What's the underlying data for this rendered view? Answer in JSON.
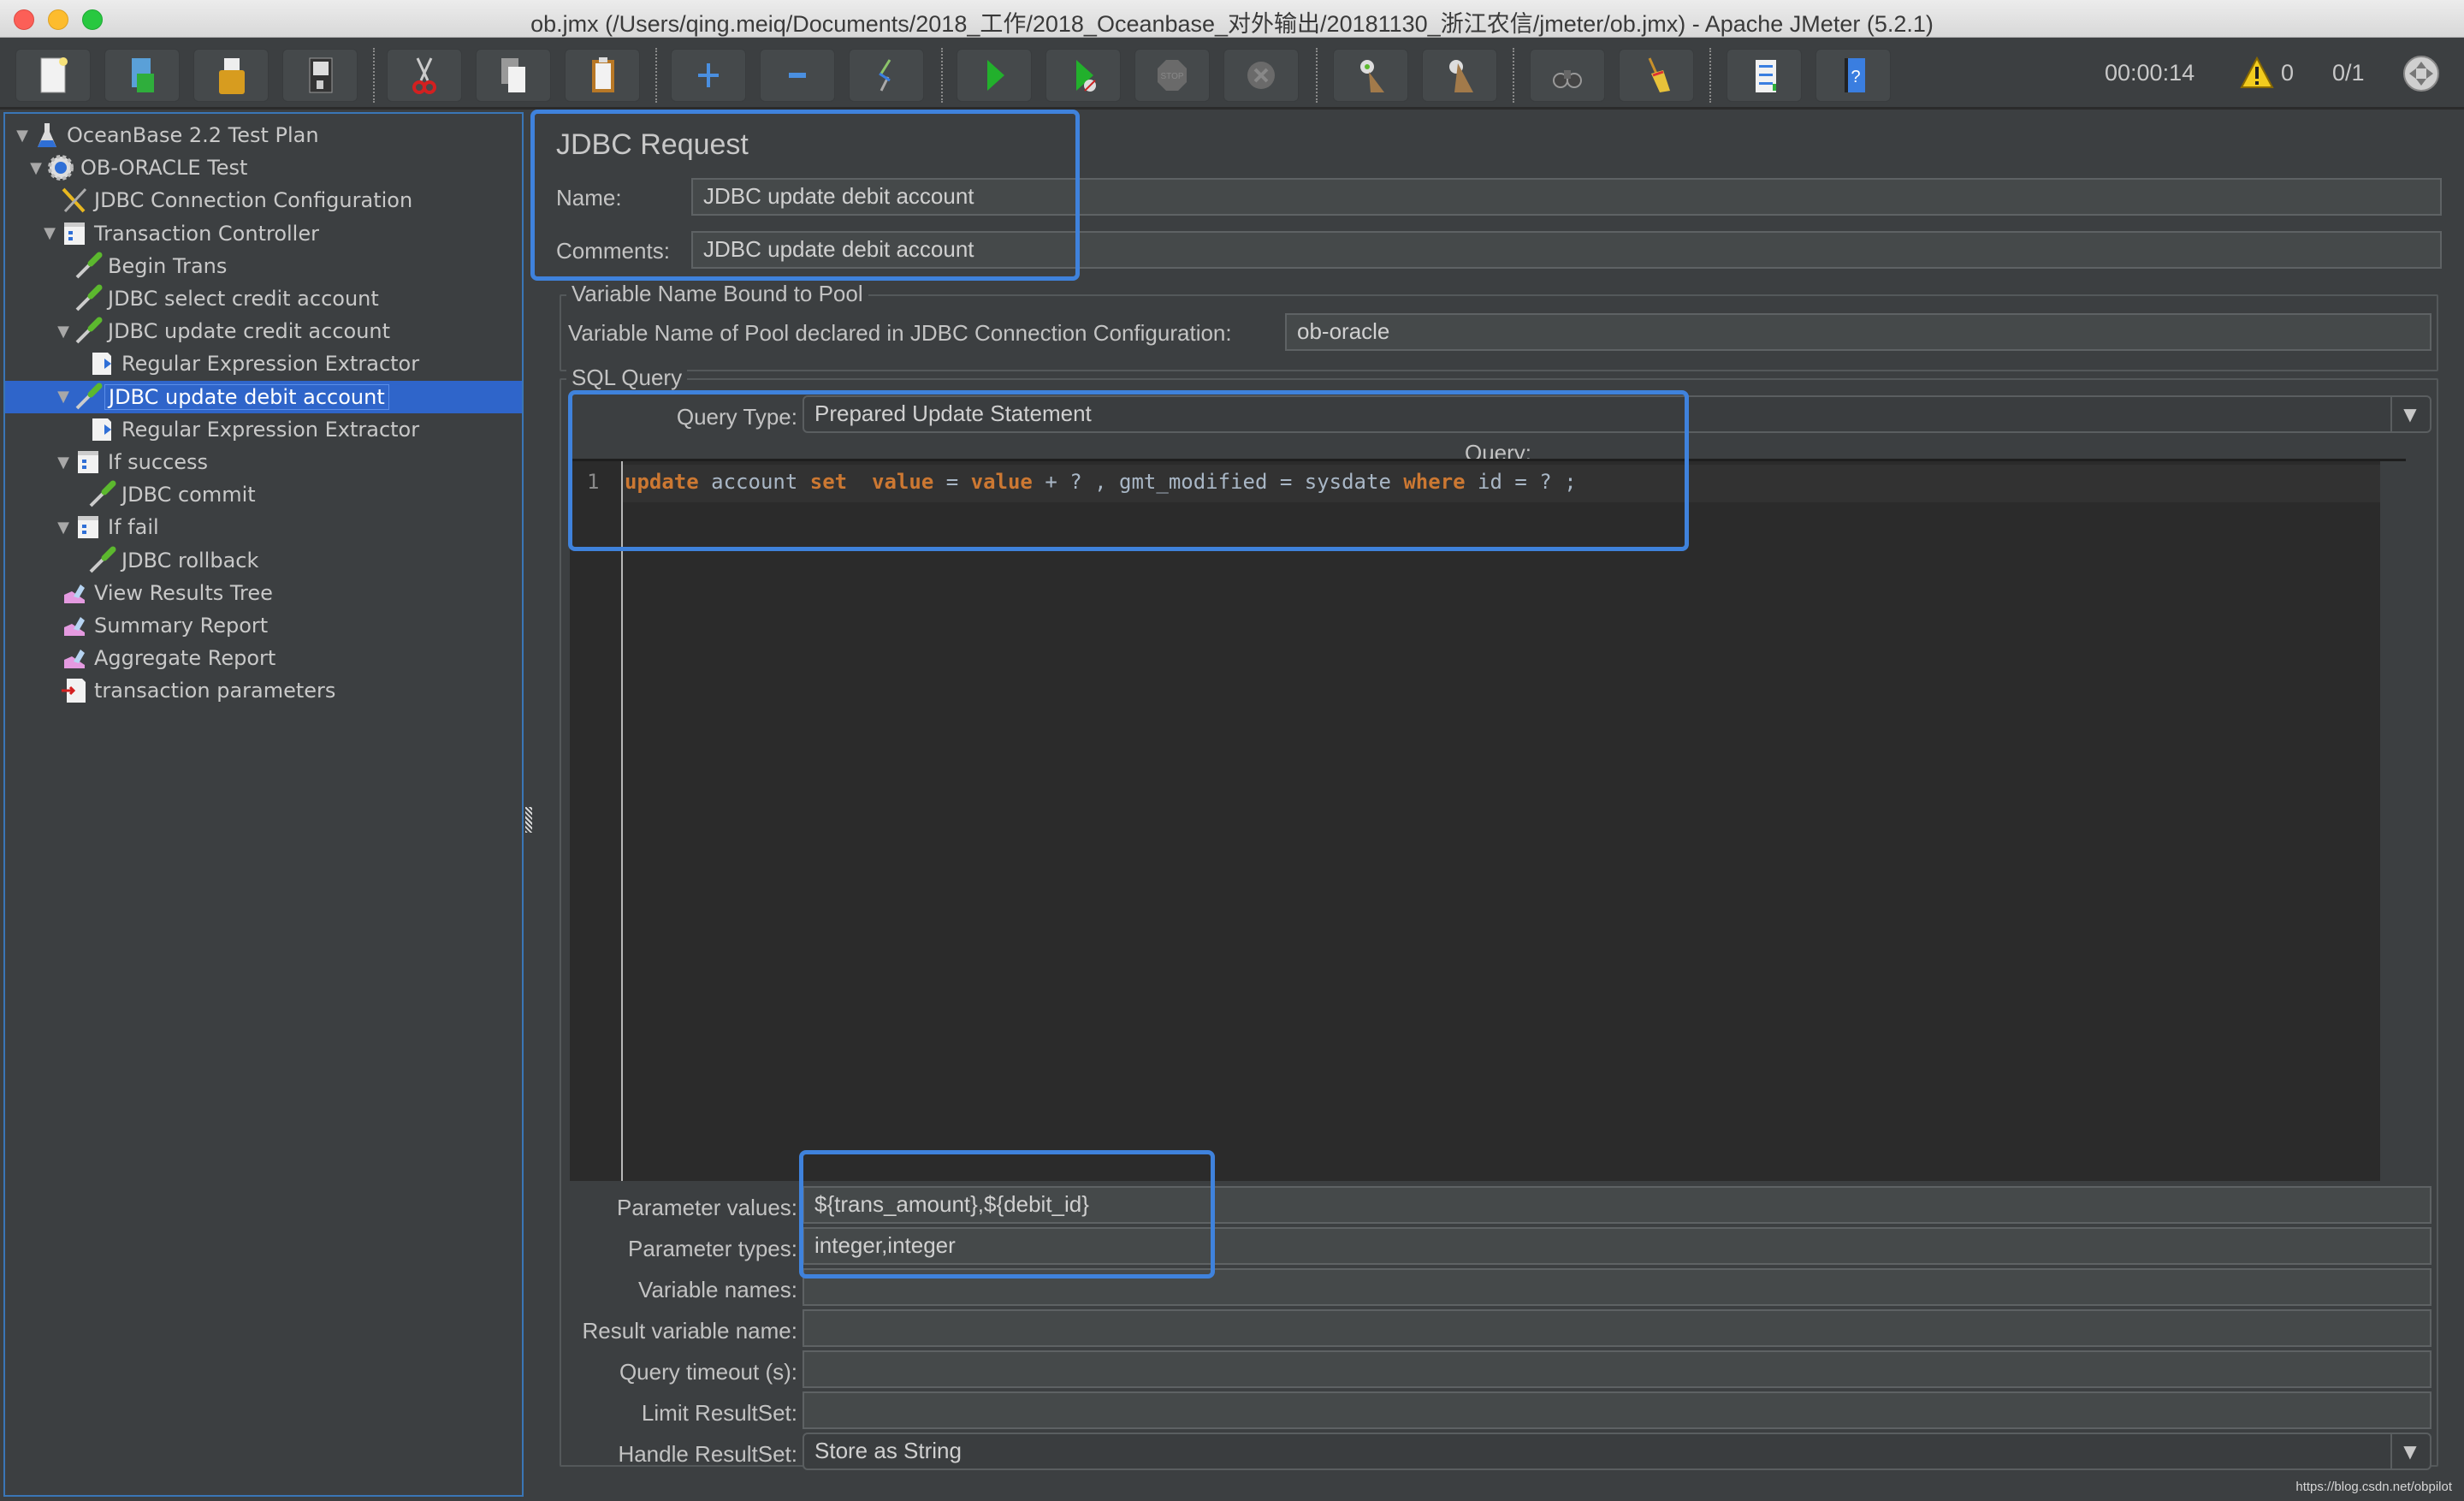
{
  "window": {
    "title": "ob.jmx (/Users/qing.meiq/Documents/2018_工作/2018_Oceanbase_对外输出/20181130_浙江农信/jmeter/ob.jmx) - Apache JMeter (5.2.1)"
  },
  "toolbar": {
    "buttons": [
      {
        "name": "new",
        "icon": "new-document-icon"
      },
      {
        "name": "templates",
        "icon": "templates-icon"
      },
      {
        "name": "open",
        "icon": "open-folder-icon"
      },
      {
        "name": "save",
        "icon": "save-disk-icon"
      },
      {
        "name": "cut",
        "icon": "scissors-icon"
      },
      {
        "name": "copy",
        "icon": "copy-icon"
      },
      {
        "name": "paste",
        "icon": "clipboard-icon"
      },
      {
        "name": "expand",
        "icon": "plus-icon"
      },
      {
        "name": "collapse",
        "icon": "minus-icon"
      },
      {
        "name": "toggle",
        "icon": "toggle-wand-icon"
      },
      {
        "name": "start",
        "icon": "play-icon"
      },
      {
        "name": "start-no-pauses",
        "icon": "play-no-timer-icon"
      },
      {
        "name": "stop",
        "icon": "stop-sign-icon"
      },
      {
        "name": "shutdown",
        "icon": "shutdown-icon"
      },
      {
        "name": "clear",
        "icon": "clear-broom-icon"
      },
      {
        "name": "clear-all",
        "icon": "clear-all-broom-icon"
      },
      {
        "name": "search",
        "icon": "binoculars-icon"
      },
      {
        "name": "reset-search",
        "icon": "reset-broom-icon"
      },
      {
        "name": "function-helper",
        "icon": "function-list-icon"
      },
      {
        "name": "help",
        "icon": "help-book-icon"
      }
    ],
    "elapsed_time": "00:00:14",
    "warning_count": "0",
    "threads": "0/1"
  },
  "tree": {
    "items": [
      {
        "label": "OceanBase 2.2 Test Plan",
        "icon": "test-plan-flask-icon",
        "level": 0,
        "expanded": true
      },
      {
        "label": "OB-ORACLE Test",
        "icon": "thread-group-gear-icon",
        "level": 1,
        "expanded": true
      },
      {
        "label": "JDBC Connection Configuration",
        "icon": "config-tools-icon",
        "level": 2,
        "expanded": null
      },
      {
        "label": "Transaction Controller",
        "icon": "controller-icon",
        "level": 2,
        "expanded": true
      },
      {
        "label": "Begin Trans",
        "icon": "sampler-pipette-icon",
        "level": 3,
        "expanded": null
      },
      {
        "label": "JDBC select credit account",
        "icon": "sampler-pipette-icon",
        "level": 3,
        "expanded": null
      },
      {
        "label": "JDBC update credit account",
        "icon": "sampler-pipette-icon",
        "level": 3,
        "expanded": true
      },
      {
        "label": "Regular Expression Extractor",
        "icon": "post-processor-icon",
        "level": 4,
        "expanded": null
      },
      {
        "label": "JDBC update debit account",
        "icon": "sampler-pipette-icon",
        "level": 3,
        "expanded": true,
        "selected": true
      },
      {
        "label": "Regular Expression Extractor",
        "icon": "post-processor-icon",
        "level": 4,
        "expanded": null
      },
      {
        "label": "If success",
        "icon": "controller-icon",
        "level": 3,
        "expanded": true
      },
      {
        "label": "JDBC commit",
        "icon": "sampler-pipette-icon",
        "level": 4,
        "expanded": null
      },
      {
        "label": "If fail",
        "icon": "controller-icon",
        "level": 3,
        "expanded": true
      },
      {
        "label": "JDBC rollback",
        "icon": "sampler-pipette-icon",
        "level": 4,
        "expanded": null
      },
      {
        "label": "View Results Tree",
        "icon": "listener-chart-icon",
        "level": 2,
        "expanded": null
      },
      {
        "label": "Summary Report",
        "icon": "listener-chart-icon",
        "level": 2,
        "expanded": null
      },
      {
        "label": "Aggregate Report",
        "icon": "listener-chart-icon",
        "level": 2,
        "expanded": null
      },
      {
        "label": "transaction parameters",
        "icon": "csv-data-set-icon",
        "level": 2,
        "expanded": null
      }
    ]
  },
  "form": {
    "heading": "JDBC Request",
    "name_label": "Name:",
    "name_value": "JDBC update debit account",
    "comments_label": "Comments:",
    "comments_value": "JDBC update debit account",
    "pool_group_title": "Variable Name Bound to Pool",
    "pool_label": "Variable Name of Pool declared in JDBC Connection Configuration:",
    "pool_value": "ob-oracle",
    "sql_group_title": "SQL Query",
    "query_type_label": "Query Type:",
    "query_type_value": "Prepared Update Statement",
    "query_label": "Query:",
    "query_line_number": "1",
    "query_tokens": [
      {
        "t": "update",
        "kw": true
      },
      {
        "t": " account ",
        "kw": false
      },
      {
        "t": "set",
        "kw": true
      },
      {
        "t": "  ",
        "kw": false
      },
      {
        "t": "value",
        "kw": true
      },
      {
        "t": " = ",
        "kw": false
      },
      {
        "t": "value",
        "kw": true
      },
      {
        "t": " + ? , gmt_modified = sysdate ",
        "kw": false
      },
      {
        "t": "where",
        "kw": true
      },
      {
        "t": " id = ? ;",
        "kw": false
      }
    ],
    "param_values_label": "Parameter values:",
    "param_values_value": "${trans_amount},${debit_id}",
    "param_types_label": "Parameter types:",
    "param_types_value": "integer,integer",
    "variable_names_label": "Variable names:",
    "variable_names_value": "",
    "result_var_label": "Result variable name:",
    "result_var_value": "",
    "query_timeout_label": "Query timeout (s):",
    "query_timeout_value": "",
    "limit_resultset_label": "Limit ResultSet:",
    "limit_resultset_value": "",
    "handle_resultset_label": "Handle ResultSet:",
    "handle_resultset_value": "Store as String"
  },
  "watermark": "https://blog.csdn.net/obpilot",
  "colors": {
    "selection": "#2f65ca",
    "highlight_box": "#3f82dc",
    "sql_keyword": "#cc7832"
  }
}
